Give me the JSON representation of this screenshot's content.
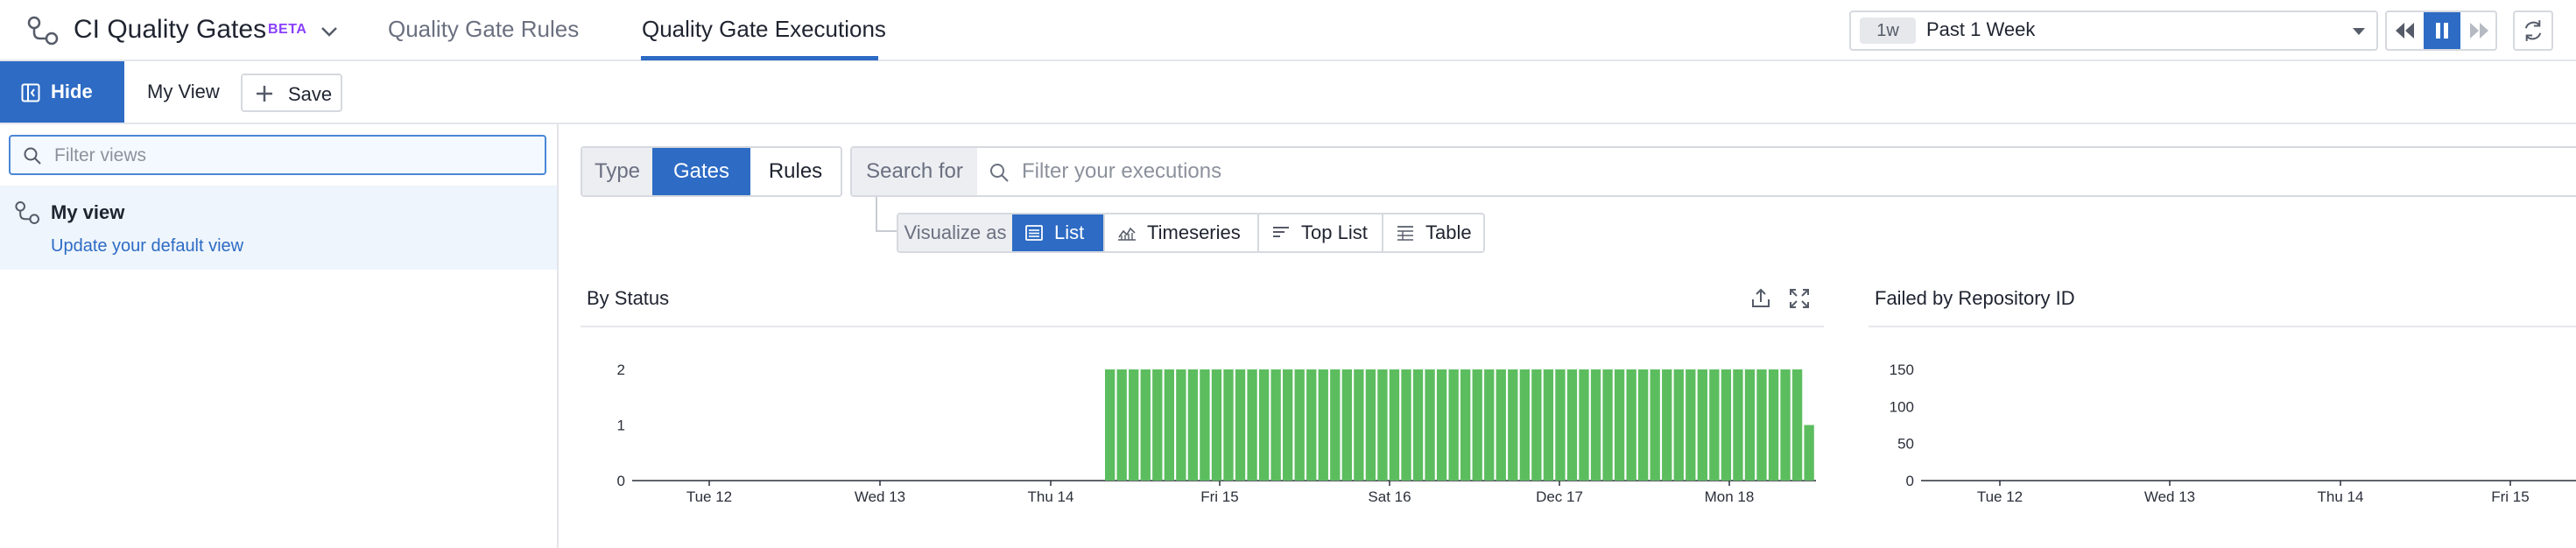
{
  "header": {
    "app_title": "CI Quality Gates",
    "badge": "BETA",
    "tabs": [
      {
        "label": "Quality Gate Rules",
        "active": false
      },
      {
        "label": "Quality Gate Executions",
        "active": true
      }
    ],
    "time_range": {
      "chip": "1w",
      "label": "Past 1 Week"
    },
    "playback_state": "paused",
    "colors": {
      "accent": "#2d6bc4",
      "badge": "#8a3ffc"
    }
  },
  "views_bar": {
    "hide_label": "Hide",
    "current_view": "My View",
    "save_label": "Save"
  },
  "sidebar": {
    "filter_placeholder": "Filter views",
    "views": [
      {
        "name": "My view",
        "link": "Update your default view"
      }
    ]
  },
  "main": {
    "type": {
      "label": "Type",
      "options": [
        "Gates",
        "Rules"
      ],
      "selected": "Gates"
    },
    "search": {
      "label": "Search for",
      "placeholder": "Filter your executions"
    },
    "visualize": {
      "label": "Visualize as",
      "options": [
        {
          "label": "List",
          "icon": "list-icon",
          "selected": true
        },
        {
          "label": "Timeseries",
          "icon": "timeseries-icon",
          "selected": false
        },
        {
          "label": "Top List",
          "icon": "toplist-icon",
          "selected": false
        },
        {
          "label": "Table",
          "icon": "table-icon",
          "selected": false
        }
      ]
    },
    "panels": [
      {
        "title": "By Status"
      },
      {
        "title": "Failed by Repository ID"
      }
    ]
  },
  "chart_data": [
    {
      "type": "bar",
      "title": "By Status",
      "x_ticks": [
        "Tue 12",
        "Wed 13",
        "Thu 14",
        "Fri 15",
        "Sat 16",
        "Dec 17",
        "Mon 18"
      ],
      "y_ticks": [
        0,
        1,
        2
      ],
      "ylim": [
        0,
        2
      ],
      "series": [
        {
          "color": "#5cbd5f",
          "values": [
            2,
            2,
            2,
            2,
            2,
            2,
            2,
            2,
            2,
            2,
            2,
            2,
            2,
            2,
            2,
            2,
            2,
            2,
            2,
            2,
            2,
            2,
            2,
            2,
            2,
            2,
            2,
            2,
            2,
            2,
            2,
            2,
            2,
            2,
            2,
            2,
            2,
            2,
            2,
            2,
            2,
            2,
            2,
            2,
            2,
            2,
            2,
            2,
            2,
            2,
            2,
            2,
            2,
            2,
            2,
            2,
            2,
            2,
            2,
            1
          ]
        }
      ],
      "grid": false,
      "legend": "none"
    },
    {
      "type": "bar",
      "title": "Failed by Repository ID",
      "x_ticks": [
        "Tue 12",
        "Wed 13",
        "Thu 14",
        "Fri 15"
      ],
      "y_ticks": [
        0,
        50,
        100,
        150
      ],
      "ylim": [
        0,
        150
      ],
      "series": [],
      "grid": false,
      "legend": "none"
    }
  ]
}
